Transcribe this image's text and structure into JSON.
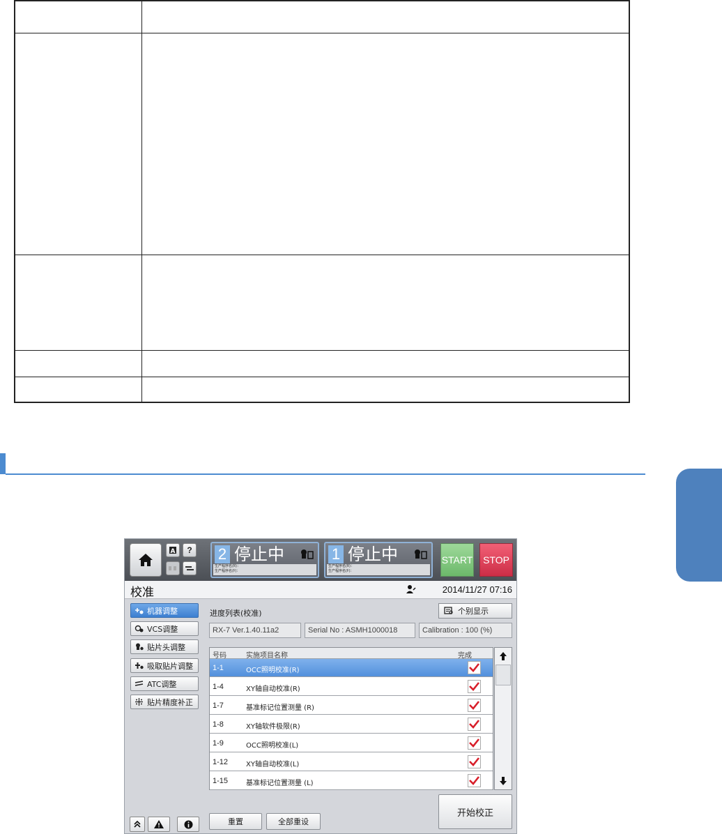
{
  "header": {
    "mode_label": "2",
    "panel_2": {
      "number": "2",
      "state": "停止中",
      "prog_line1": "生产程序名(R)：",
      "prog_line2": "生产程序名(F)："
    },
    "panel_1": {
      "number": "1",
      "state": "停止中",
      "prog_line1": "生产程序名(R)：",
      "prog_line2": "生产程序名(F)："
    },
    "help_label": "?",
    "start_label": "START",
    "stop_label": "STOP"
  },
  "titlebar": {
    "title": "校准",
    "datetime": "2014/11/27 07:16"
  },
  "sidebar": {
    "items": [
      {
        "label": "机器调整",
        "active": true
      },
      {
        "label": "VCS调整",
        "active": false
      },
      {
        "label": "贴片头调整",
        "active": false
      },
      {
        "label": "吸取贴片调整",
        "active": false
      },
      {
        "label": "ATC调整",
        "active": false
      },
      {
        "label": "贴片精度补正",
        "active": false
      }
    ]
  },
  "main": {
    "progress_label": "进度列表(校准)",
    "individual_display_label": "个别显示",
    "info": {
      "version": "RX-7 Ver.1.40.11a2",
      "serial": "Serial No : ASMH1000018",
      "calibration": "Calibration : 100 (%)"
    },
    "table": {
      "headers": {
        "code": "号码",
        "name": "实施项目名称",
        "done": "完成"
      },
      "rows": [
        {
          "code": "1-1",
          "name": "OCC照明校准(R)",
          "done": true,
          "selected": true
        },
        {
          "code": "1-4",
          "name": "XY轴自动校准(R)",
          "done": true,
          "selected": false
        },
        {
          "code": "1-7",
          "name": "基准标记位置测量 (R)",
          "done": true,
          "selected": false
        },
        {
          "code": "1-8",
          "name": "XY轴软件极限(R)",
          "done": true,
          "selected": false
        },
        {
          "code": "1-9",
          "name": "OCC照明校准(L)",
          "done": true,
          "selected": false
        },
        {
          "code": "1-12",
          "name": "XY轴自动校准(L)",
          "done": true,
          "selected": false
        },
        {
          "code": "1-15",
          "name": "基准标记位置测量 (L)",
          "done": true,
          "selected": false
        }
      ]
    },
    "buttons": {
      "reset": "重置",
      "reset_all": "全部重设",
      "start_calibration": "开始校正"
    }
  },
  "colors": {
    "accent_blue": "#4c8bd0",
    "side_tab": "#4e81bd",
    "start_green": "#7cc47a",
    "stop_red": "#e03a55",
    "check_red": "#d81f2a"
  }
}
